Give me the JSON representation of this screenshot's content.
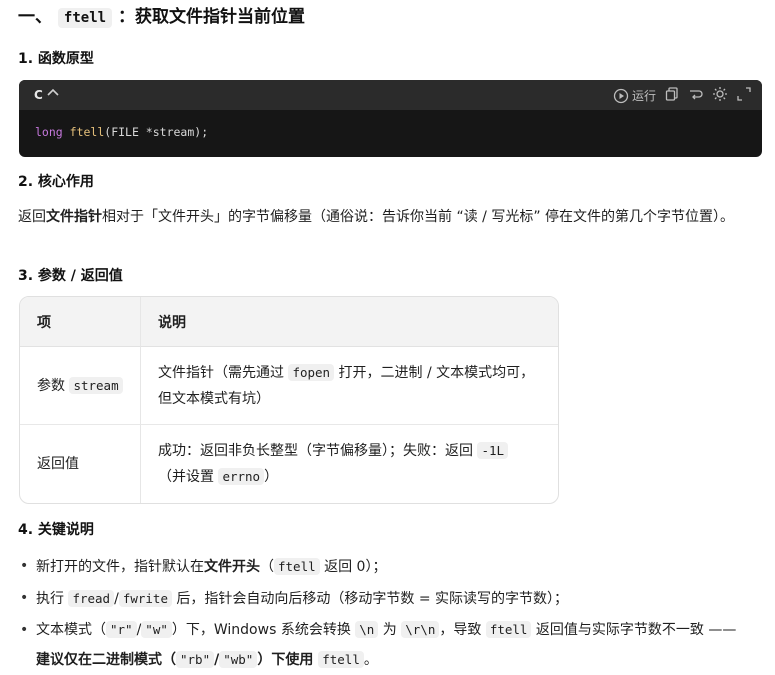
{
  "title": {
    "prefix": "一、",
    "code": "ftell",
    "suffix": "：获取文件指针当前位置"
  },
  "sections": {
    "s1": "1. 函数原型",
    "s2": "2. 核心作用",
    "s3": "3. 参数 / 返回值",
    "s4": "4. 关键说明"
  },
  "codeblock": {
    "lang": "C",
    "caret": "^",
    "run_label": "运行",
    "code_kw": "long",
    "code_fn": "ftell",
    "code_rest": "(FILE *stream);"
  },
  "desc": {
    "t1": "返回",
    "bold": "文件指针",
    "t2": "相对于「文件开头」的字节偏移量（通俗说：告诉你当前 “读 / 写光标” 停在文件的第几个字节位置）。"
  },
  "table": {
    "headers": [
      "项",
      "说明"
    ],
    "rows": [
      {
        "c1_text": "参数 ",
        "c1_code": "stream",
        "c2_a": "文件指针（需先通过 ",
        "c2_code": "fopen",
        "c2_b": " 打开，二进制 / 文本模式均可，但文本模式有坑）"
      },
      {
        "c1_text": "返回值",
        "c2_a": "成功：返回非负长整型（字节偏移量）；失败：返回 ",
        "c2_code": "-1L",
        "c2_b": "（并设置 ",
        "c2_code2": "errno",
        "c2_c": "）"
      }
    ]
  },
  "list": {
    "i1_a": "新打开的文件，指针默认在",
    "i1_bold": "文件开头",
    "i1_b": "（",
    "i1_code": "ftell",
    "i1_c": " 返回 0）；",
    "i2_a": "执行 ",
    "i2_code1": "fread",
    "i2_sep": "/",
    "i2_code2": "fwrite",
    "i2_b": " 后，指针会自动向后移动（移动字节数 = 实际读写的字节数）；",
    "i3_a": "文本模式（",
    "i3_code1": "\"r\"",
    "i3_slash1": "/",
    "i3_code2": "\"w\"",
    "i3_b": "）下，Windows 系统会转换 ",
    "i3_code3": "\\n",
    "i3_c": " 为 ",
    "i3_code4": "\\r\\n",
    "i3_d": "，导致 ",
    "i3_code5": "ftell",
    "i3_e": " 返回值与实际字节数不一致 ——",
    "i3_bold1": "建议仅在二进制模式（",
    "i3_code6": "\"rb\"",
    "i3_slash2": "/",
    "i3_code7": "\"wb\"",
    "i3_bold2": "）下使用 ",
    "i3_code8": "ftell",
    "i3_end": "。"
  },
  "icons": [
    "run-icon",
    "copy-icon",
    "wrap-icon",
    "theme-icon",
    "expand-icon"
  ]
}
